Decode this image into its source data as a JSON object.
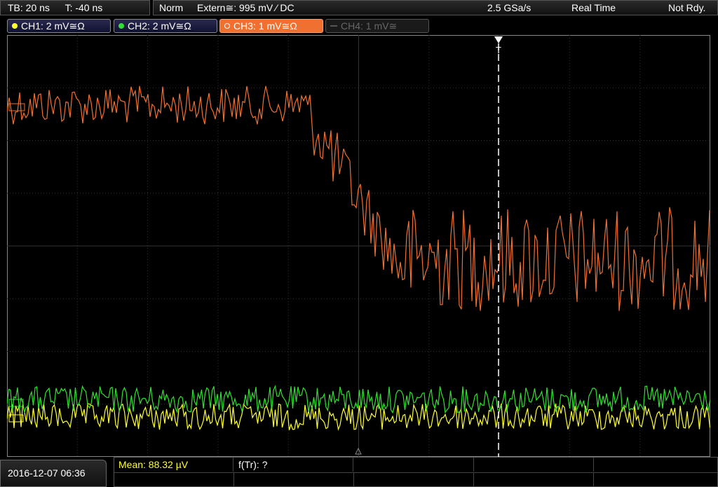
{
  "timebase": {
    "tb": "TB: 20 ns",
    "t": "T: -40 ns"
  },
  "trigger": {
    "mode": "Norm",
    "source": "Extern≅: 995 mV ⁄ DC",
    "sample_rate": "2.5 GSa/s",
    "acq": "Real Time",
    "status": "Not Rdy."
  },
  "channels": [
    {
      "label": "CH1: 2 mV≅Ω",
      "color": "#ffff30"
    },
    {
      "label": "CH2: 2 mV≅Ω",
      "color": "#30e030"
    },
    {
      "label": "CH3: 1 mV≅Ω",
      "color": "#f07030"
    },
    {
      "label": "CH4: 1 mV≅",
      "color": "#666666"
    }
  ],
  "trigger_marker": "T",
  "footer": {
    "datetime": "2016-12-07 06:36",
    "mean": "Mean: 88.32 µV",
    "ftr": "f(Tr): ?"
  },
  "colors": {
    "ch1": "#ffff30",
    "ch2": "#30e030",
    "ch3": "#f07030",
    "grid": "#3a3a3a"
  }
}
